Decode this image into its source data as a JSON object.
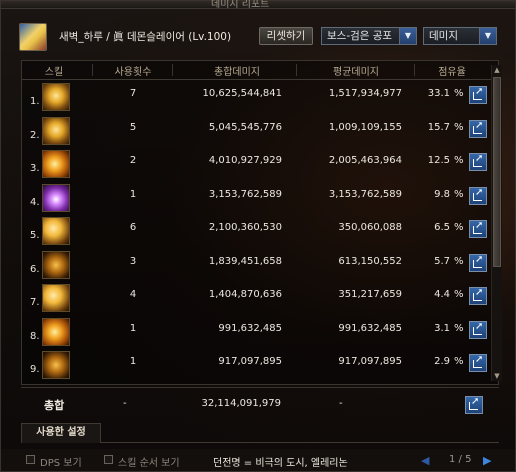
{
  "window": {
    "title": "데미지 리포트"
  },
  "header": {
    "character": "새벽_하루 / 眞 데몬슬레이어 (Lv.100)",
    "reset_label": "리셋하기",
    "boss_select": "보스-검은 공포",
    "metric_select": "데미지"
  },
  "table": {
    "columns": [
      "스킬",
      "사용횟수",
      "총합데미지",
      "평균데미지",
      "점유율"
    ],
    "rows": [
      {
        "rank": "1.",
        "icon": "skill-icon-gold-claw",
        "count": "7",
        "total": "10,625,544,841",
        "avg": "1,517,934,977",
        "pct": "33.1",
        "sign": "%"
      },
      {
        "rank": "2.",
        "icon": "skill-icon-gold-spikes",
        "count": "5",
        "total": "5,045,545,776",
        "avg": "1,009,109,155",
        "pct": "15.7",
        "sign": "%"
      },
      {
        "rank": "3.",
        "icon": "skill-icon-gold-slash",
        "count": "2",
        "total": "4,010,927,929",
        "avg": "2,005,463,964",
        "pct": "12.5",
        "sign": "%"
      },
      {
        "rank": "4.",
        "icon": "skill-icon-purple-flame",
        "count": "1",
        "total": "3,153,762,589",
        "avg": "3,153,762,589",
        "pct": "9.8",
        "sign": "%"
      },
      {
        "rank": "5.",
        "icon": "skill-icon-gold-wing",
        "count": "6",
        "total": "2,100,360,530",
        "avg": "350,060,088",
        "pct": "6.5",
        "sign": "%"
      },
      {
        "rank": "6.",
        "icon": "skill-icon-gold-crescent",
        "count": "3",
        "total": "1,839,451,658",
        "avg": "613,150,552",
        "pct": "5.7",
        "sign": "%"
      },
      {
        "rank": "7.",
        "icon": "skill-icon-gold-dragon",
        "count": "4",
        "total": "1,404,870,636",
        "avg": "351,217,659",
        "pct": "4.4",
        "sign": "%"
      },
      {
        "rank": "8.",
        "icon": "skill-icon-fire-blade",
        "count": "1",
        "total": "991,632,485",
        "avg": "991,632,485",
        "pct": "3.1",
        "sign": "%"
      },
      {
        "rank": "9.",
        "icon": "skill-icon-dark-chain",
        "count": "1",
        "total": "917,097,895",
        "avg": "917,097,895",
        "pct": "2.9",
        "sign": "%"
      }
    ]
  },
  "total": {
    "label": "총합",
    "count": "-",
    "sum": "32,114,091,979",
    "avg": "-"
  },
  "tabs": {
    "settings": "사용한 설정"
  },
  "footer": {
    "dps_label": "DPS 보기",
    "order_label": "스킬 순서 보기",
    "dungeon": "던전명 = 비극의 도시, 엘레리논",
    "page": "1 / 5"
  },
  "colors": {
    "share_button": "#2a5694",
    "header_text": "#b8aa92"
  }
}
